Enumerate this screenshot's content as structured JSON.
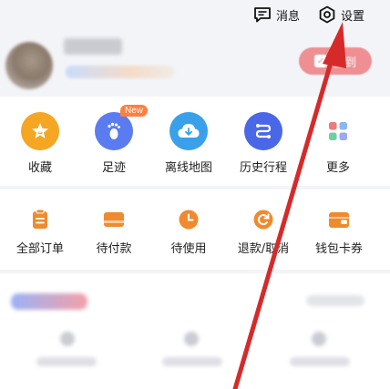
{
  "header": {
    "messages_label": "消息",
    "settings_label": "设置"
  },
  "profile": {
    "checkin_label": "签到"
  },
  "quick_actions": [
    {
      "label": "收藏",
      "icon": "star-icon",
      "color": "#f5a623"
    },
    {
      "label": "足迹",
      "icon": "footprint-icon",
      "color": "#5b7cf0",
      "badge": "New"
    },
    {
      "label": "离线地图",
      "icon": "cloud-download-icon",
      "color": "#3aa0ea"
    },
    {
      "label": "历史行程",
      "icon": "route-icon",
      "color": "#4a67e8"
    },
    {
      "label": "更多",
      "icon": "grid-icon",
      "color": "#7f8fa8"
    }
  ],
  "orders": [
    {
      "label": "全部订单",
      "icon": "clipboard-icon",
      "color": "#f08a2e"
    },
    {
      "label": "待付款",
      "icon": "card-icon",
      "color": "#f08a2e"
    },
    {
      "label": "待使用",
      "icon": "clock-icon",
      "color": "#f08a2e"
    },
    {
      "label": "退款/取消",
      "icon": "refund-icon",
      "color": "#f08a2e"
    },
    {
      "label": "钱包卡券",
      "icon": "wallet-icon",
      "color": "#f08a2e"
    }
  ],
  "colors": {
    "arrow": "#d62a2a",
    "checkin_bg": "#ee8f93",
    "accent_orange": "#f08a2e"
  }
}
